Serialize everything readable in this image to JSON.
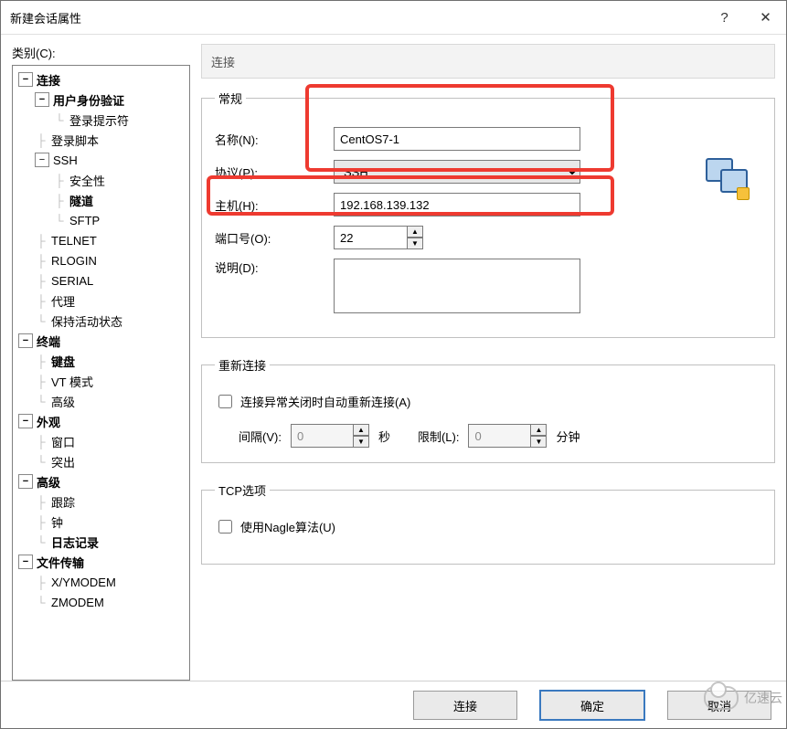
{
  "window": {
    "title": "新建会话属性",
    "help_glyph": "?",
    "close_glyph": "✕"
  },
  "category_label": "类别(C):",
  "tree": {
    "connection": "连接",
    "user_auth": "用户身份验证",
    "login_prompt": "登录提示符",
    "login_script": "登录脚本",
    "ssh": "SSH",
    "security": "安全性",
    "tunnel": "隧道",
    "sftp": "SFTP",
    "telnet": "TELNET",
    "rlogin": "RLOGIN",
    "serial": "SERIAL",
    "proxy": "代理",
    "keepalive": "保持活动状态",
    "terminal": "终端",
    "keyboard": "键盘",
    "vt_mode": "VT 模式",
    "advanced_term": "高级",
    "appearance": "外观",
    "window": "窗口",
    "highlight": "突出",
    "advanced": "高级",
    "trace": "跟踪",
    "bell": "钟",
    "logging": "日志记录",
    "file_transfer": "文件传输",
    "xymodem": "X/YMODEM",
    "zmodem": "ZMODEM"
  },
  "pane_title": "连接",
  "general": {
    "legend": "常规",
    "name_label": "名称(N):",
    "name_value": "CentOS7-1",
    "protocol_label": "协议(P):",
    "protocol_value": "SSH",
    "host_label": "主机(H):",
    "host_value": "192.168.139.132",
    "port_label": "端口号(O):",
    "port_value": "22",
    "desc_label": "说明(D):",
    "desc_value": ""
  },
  "reconnect": {
    "legend": "重新连接",
    "auto_label": "连接异常关闭时自动重新连接(A)",
    "interval_label": "间隔(V):",
    "interval_value": "0",
    "seconds_label": "秒",
    "limit_label": "限制(L):",
    "limit_value": "0",
    "minutes_label": "分钟"
  },
  "tcp": {
    "legend": "TCP选项",
    "nagle_label": "使用Nagle算法(U)"
  },
  "footer": {
    "connect": "连接",
    "ok": "确定",
    "cancel": "取消"
  },
  "watermark": "亿速云"
}
